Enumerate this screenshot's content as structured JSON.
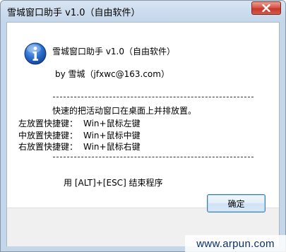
{
  "window": {
    "title": "雪城窗口助手 v1.0（自由软件）"
  },
  "dialog": {
    "heading": "雪城窗口助手 v1.0（自由软件）",
    "author": "by 雪城（jfxwc@163.com）",
    "description": "快速的把活动窗口在桌面上并排放置。",
    "hotkeys": [
      {
        "label": "左放置快捷键：",
        "value": "Win+鼠标左键"
      },
      {
        "label": "中放置快捷键：",
        "value": "Win+鼠标中键"
      },
      {
        "label": "右放置快捷键：",
        "value": "Win+鼠标右键"
      }
    ],
    "exit_hint": "用 [ALT]+[ESC] 结束程序",
    "ok_label": "确定"
  },
  "watermark": "www.arpun.com",
  "colors": {
    "close_button": "#c7372b",
    "info_icon": "#1f5fb8",
    "title_bar": "#c4d6ea"
  }
}
